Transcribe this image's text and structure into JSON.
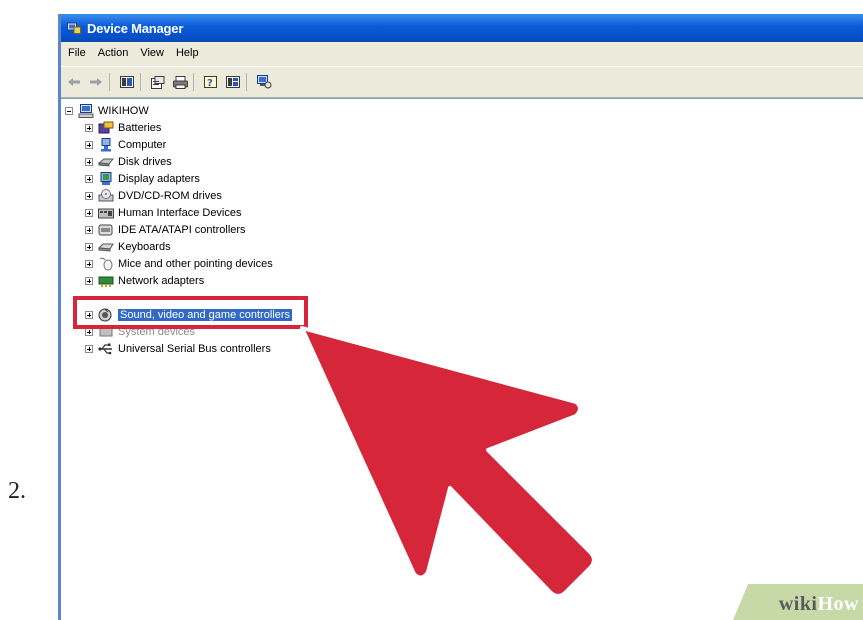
{
  "step": {
    "number": "2."
  },
  "window": {
    "title": "Device Manager",
    "accent_color": "#0a5ad8"
  },
  "menu": [
    "File",
    "Action",
    "View",
    "Help"
  ],
  "toolbar": {
    "buttons": [
      "back-icon",
      "forward-icon",
      "show-hide-console-tree-icon",
      "properties-icon",
      "print-icon",
      "help-icon",
      "view-icon",
      "scan-hardware-icon"
    ]
  },
  "tree": {
    "root": "WIKIHOW",
    "items": [
      {
        "label": "Batteries",
        "icon": "battery-icon"
      },
      {
        "label": "Computer",
        "icon": "computer-icon"
      },
      {
        "label": "Disk drives",
        "icon": "disk-drive-icon"
      },
      {
        "label": "Display adapters",
        "icon": "display-adapter-icon"
      },
      {
        "label": "DVD/CD-ROM drives",
        "icon": "dvd-drive-icon"
      },
      {
        "label": "Human Interface Devices",
        "icon": "hid-icon"
      },
      {
        "label": "IDE ATA/ATAPI controllers",
        "icon": "ide-controller-icon"
      },
      {
        "label": "Keyboards",
        "icon": "keyboard-icon"
      },
      {
        "label": "Mice and other pointing devices",
        "icon": "mouse-icon"
      },
      {
        "label": "Network adapters",
        "icon": "network-adapter-icon"
      },
      {
        "label": "Sound, video and game controllers",
        "icon": "sound-icon",
        "selected": true
      },
      {
        "label": "System devices",
        "icon": "system-device-icon"
      },
      {
        "label": "Universal Serial Bus controllers",
        "icon": "usb-icon"
      }
    ]
  },
  "annotation": {
    "highlight_color": "#d6273a",
    "arrow_color": "#d6273a"
  },
  "watermark": {
    "part1": "wiki",
    "part2": "How",
    "color1": "#5a5a5a",
    "color2": "#ffffff",
    "bg": "#c7d9a7"
  }
}
